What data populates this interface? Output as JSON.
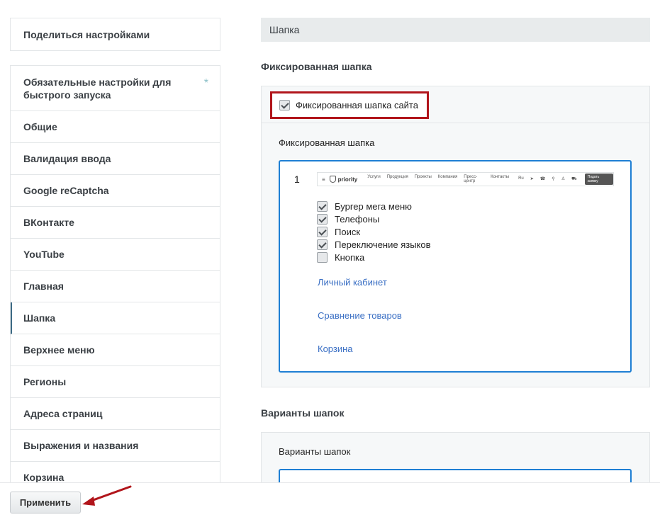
{
  "sidebar": {
    "share_label": "Поделиться настройками",
    "items": [
      {
        "label": "Обязательные настройки для быстрого запуска",
        "star": "*"
      },
      {
        "label": "Общие"
      },
      {
        "label": "Валидация ввода"
      },
      {
        "label": "Google reCaptcha"
      },
      {
        "label": "ВКонтакте"
      },
      {
        "label": "YouTube"
      },
      {
        "label": "Главная"
      },
      {
        "label": "Шапка"
      },
      {
        "label": "Верхнее меню"
      },
      {
        "label": "Регионы"
      },
      {
        "label": "Адреса страниц"
      },
      {
        "label": "Выражения и названия"
      },
      {
        "label": "Корзина"
      }
    ],
    "active_index": 7
  },
  "main": {
    "section_title": "Шапка",
    "fixed": {
      "heading": "Фиксированная шапка",
      "checkbox_label": "Фиксированная шапка сайта",
      "checkbox_checked": true,
      "panel_label": "Фиксированная шапка",
      "variant": {
        "number": "1",
        "preview": {
          "logo": "priority",
          "nav": [
            "Услуги",
            "Продукция",
            "Проекты",
            "Компания",
            "Пресс-центр",
            "Контакты"
          ],
          "lang": "Ru",
          "button": "Подать заявку"
        },
        "options": [
          {
            "label": "Бургер мега меню",
            "checked": true
          },
          {
            "label": "Телефоны",
            "checked": true
          },
          {
            "label": "Поиск",
            "checked": true
          },
          {
            "label": "Переключение языков",
            "checked": true
          },
          {
            "label": "Кнопка",
            "checked": false
          }
        ],
        "links": [
          "Личный кабинет",
          "Сравнение товаров",
          "Корзина"
        ]
      }
    },
    "variants": {
      "heading": "Варианты шапок",
      "panel_label": "Варианты шапок"
    }
  },
  "footer": {
    "apply_label": "Применить"
  },
  "colors": {
    "accent_blue": "#1e7fd4",
    "highlight_red": "#b1151b",
    "link": "#3a6fc4"
  }
}
